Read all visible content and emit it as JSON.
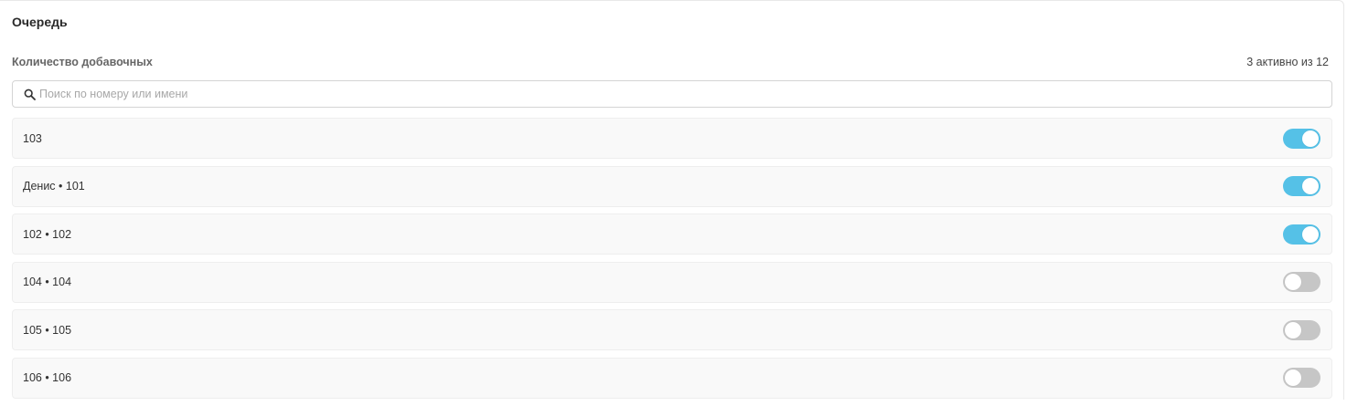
{
  "title": "Очередь",
  "section": {
    "label": "Количество добавочных",
    "count_text": "3 активно из 12"
  },
  "search": {
    "icon": "search-icon",
    "placeholder": "Поиск по номеру или имени",
    "value": ""
  },
  "extensions": [
    {
      "label": "103",
      "active": true
    },
    {
      "label": "Денис • 101",
      "active": true
    },
    {
      "label": "102 • 102",
      "active": true
    },
    {
      "label": "104 • 104",
      "active": false
    },
    {
      "label": "105 • 105",
      "active": false
    },
    {
      "label": "106 • 106",
      "active": false
    }
  ],
  "colors": {
    "toggle_on": "#55c1e7",
    "toggle_off": "#c6c6c6"
  }
}
